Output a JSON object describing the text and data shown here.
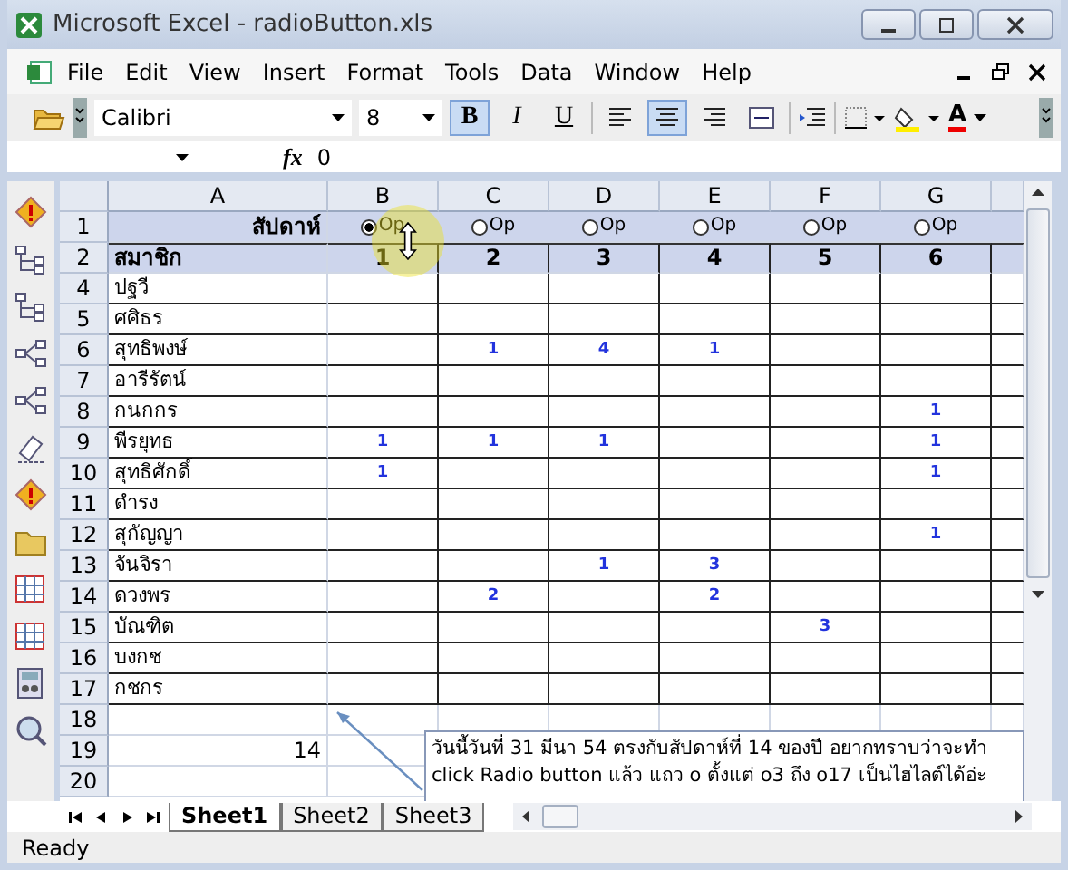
{
  "window": {
    "title": "Microsoft Excel - radioButton.xls"
  },
  "menu": [
    {
      "label": "File"
    },
    {
      "label": "Edit"
    },
    {
      "label": "View"
    },
    {
      "label": "Insert"
    },
    {
      "label": "Format"
    },
    {
      "label": "Tools"
    },
    {
      "label": "Data"
    },
    {
      "label": "Window"
    },
    {
      "label": "Help"
    }
  ],
  "toolbar": {
    "font": "Calibri",
    "size": "8",
    "font_color_label": "A",
    "style_buttons": [
      {
        "kind": "bold",
        "label": "B",
        "on": true
      },
      {
        "kind": "italic",
        "label": "I",
        "on": false
      },
      {
        "kind": "underline",
        "label": "U",
        "on": false
      }
    ],
    "align_buttons": [
      {
        "kind": "left",
        "on": false
      },
      {
        "kind": "center",
        "on": true
      },
      {
        "kind": "right",
        "on": false
      },
      {
        "kind": "merge",
        "on": false
      }
    ]
  },
  "formula_bar": {
    "function_label": "fx",
    "value": "0"
  },
  "sheet": {
    "columns": [
      "A",
      "B",
      "C",
      "D",
      "E",
      "F",
      "G"
    ],
    "radio_row": {
      "row": "1",
      "label": "สัปดาห์",
      "radios": [
        {
          "label": "Op",
          "selected": true
        },
        {
          "label": "Op",
          "selected": false
        },
        {
          "label": "Op",
          "selected": false
        },
        {
          "label": "Op",
          "selected": false
        },
        {
          "label": "Op",
          "selected": false
        },
        {
          "label": "Op",
          "selected": false
        }
      ]
    },
    "week_row": {
      "row": "2",
      "label": "สมาชิก",
      "weeks": [
        "1",
        "2",
        "3",
        "4",
        "5",
        "6"
      ]
    },
    "members": [
      {
        "row": "4",
        "name": "ปฐวี"
      },
      {
        "row": "5",
        "name": "ศศิธร"
      },
      {
        "row": "6",
        "name": "สุทธิพงษ์",
        "cells": {
          "C": "1",
          "D": "4",
          "E": "1"
        }
      },
      {
        "row": "7",
        "name": "อารีรัตน์"
      },
      {
        "row": "8",
        "name": "กนกกร",
        "cells": {
          "G": "1"
        }
      },
      {
        "row": "9",
        "name": "พีรยุทธ",
        "cells": {
          "B": "1",
          "C": "1",
          "D": "1",
          "G": "1"
        }
      },
      {
        "row": "10",
        "name": "สุทธิศักดิ์",
        "cells": {
          "B": "1",
          "G": "1"
        }
      },
      {
        "row": "11",
        "name": "ดำรง"
      },
      {
        "row": "12",
        "name": "สุกัญญา",
        "cells": {
          "G": "1"
        }
      },
      {
        "row": "13",
        "name": "จันจิรา",
        "cells": {
          "D": "1",
          "E": "3"
        }
      },
      {
        "row": "14",
        "name": "ดวงพร",
        "cells": {
          "C": "2",
          "E": "2"
        }
      },
      {
        "row": "15",
        "name": "บัณฑิต",
        "cells": {
          "F": "3"
        }
      },
      {
        "row": "16",
        "name": "บงกช"
      },
      {
        "row": "17",
        "name": "กชกร"
      }
    ],
    "extra_rows": [
      {
        "row": "18"
      },
      {
        "row": "19",
        "value": "14"
      },
      {
        "row": "20"
      }
    ],
    "comment": {
      "lines": [
        "วันนี้วันที่ 31 มีนา 54 ตรงกับสัปดาห์ที่ 14 ของปี อยากทราบว่าจะทำ",
        "click Radio button แล้ว แถว o ตั้งแต่ o3 ถึง o17 เป็นไฮไลต์ได้อ่ะ"
      ]
    }
  },
  "sheet_tabs": [
    {
      "label": "Sheet1",
      "selected": true
    },
    {
      "label": "Sheet2",
      "selected": false
    },
    {
      "label": "Sheet3",
      "selected": false
    }
  ],
  "status_bar": "Ready"
}
